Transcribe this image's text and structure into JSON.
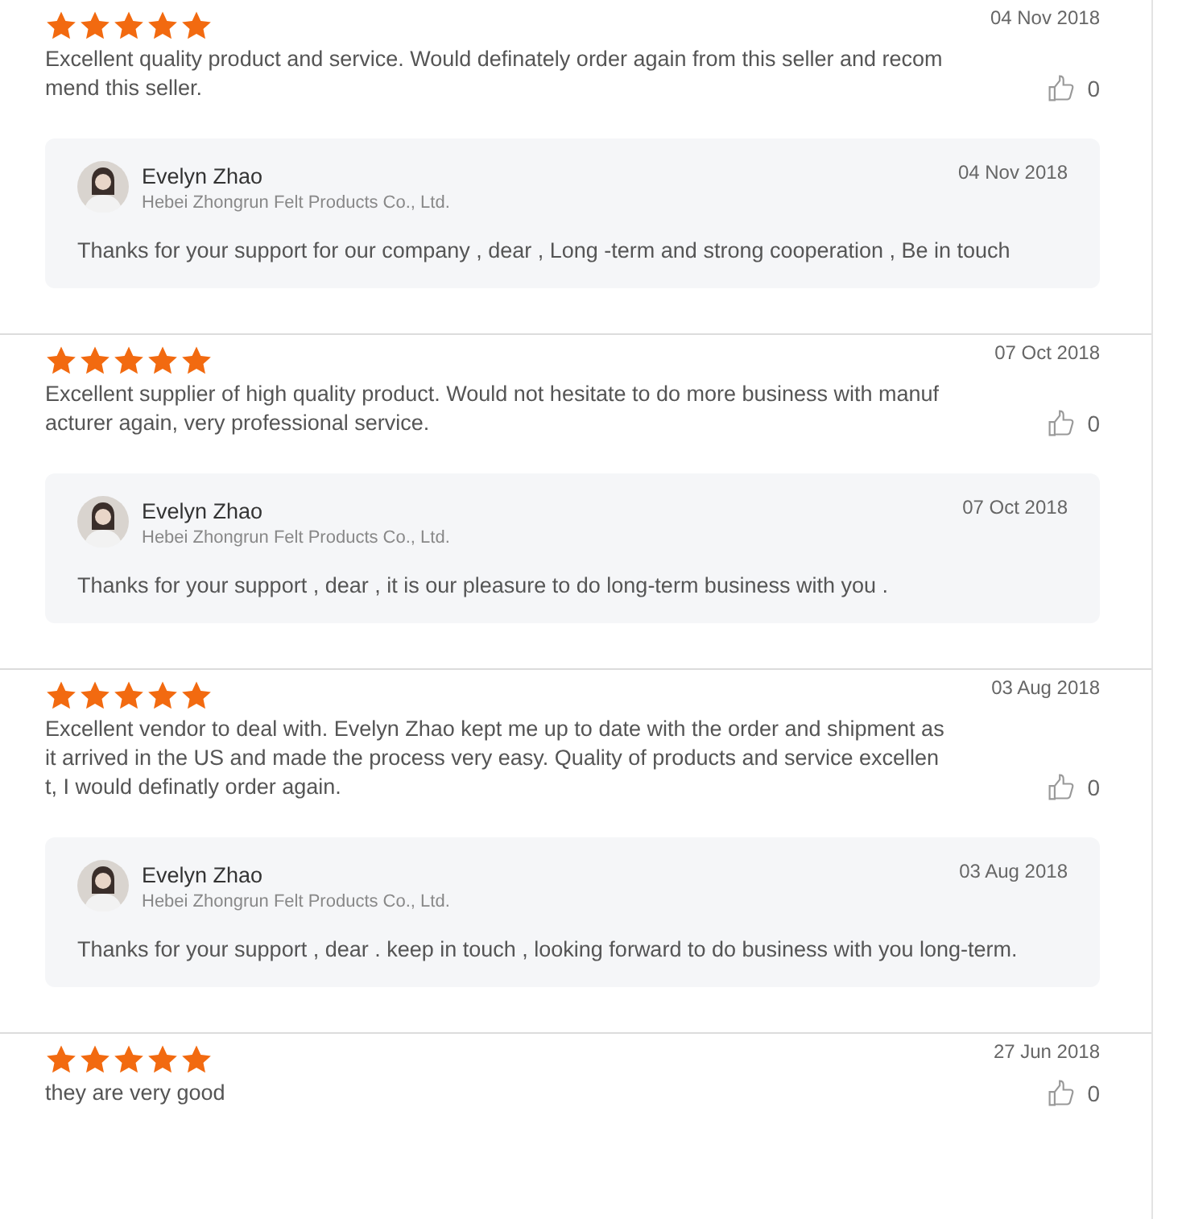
{
  "reviews": [
    {
      "stars": 5,
      "date": "04 Nov 2018",
      "text": "Excellent quality product and service. Would definately order again from this seller and recommend this seller.",
      "likes": "0",
      "reply": {
        "name": "Evelyn Zhao",
        "company": "Hebei Zhongrun Felt Products Co., Ltd.",
        "date": "04 Nov 2018",
        "text": "Thanks for your support for our company , dear , Long -term and strong cooperation , Be in touch"
      }
    },
    {
      "stars": 5,
      "date": "07 Oct 2018",
      "text": "Excellent supplier of high quality product. Would not hesitate to do more business with manufacturer again, very professional service.",
      "likes": "0",
      "reply": {
        "name": "Evelyn Zhao",
        "company": "Hebei Zhongrun Felt Products Co., Ltd.",
        "date": "07 Oct 2018",
        "text": "Thanks for your support , dear , it is our pleasure to do long-term business with you ."
      }
    },
    {
      "stars": 5,
      "date": "03 Aug 2018",
      "text": "Excellent vendor to deal with. Evelyn Zhao kept me up to date with the order and shipment as it arrived in the US and made the process very easy. Quality of products and service excellent, I would definatly order again.",
      "likes": "0",
      "reply": {
        "name": "Evelyn Zhao",
        "company": "Hebei Zhongrun Felt Products Co., Ltd.",
        "date": "03 Aug 2018",
        "text": "Thanks for your support , dear . keep in touch , looking forward to do business with you long-term."
      }
    },
    {
      "stars": 5,
      "date": "27 Jun 2018",
      "text": "they are very good",
      "likes": "0"
    }
  ]
}
